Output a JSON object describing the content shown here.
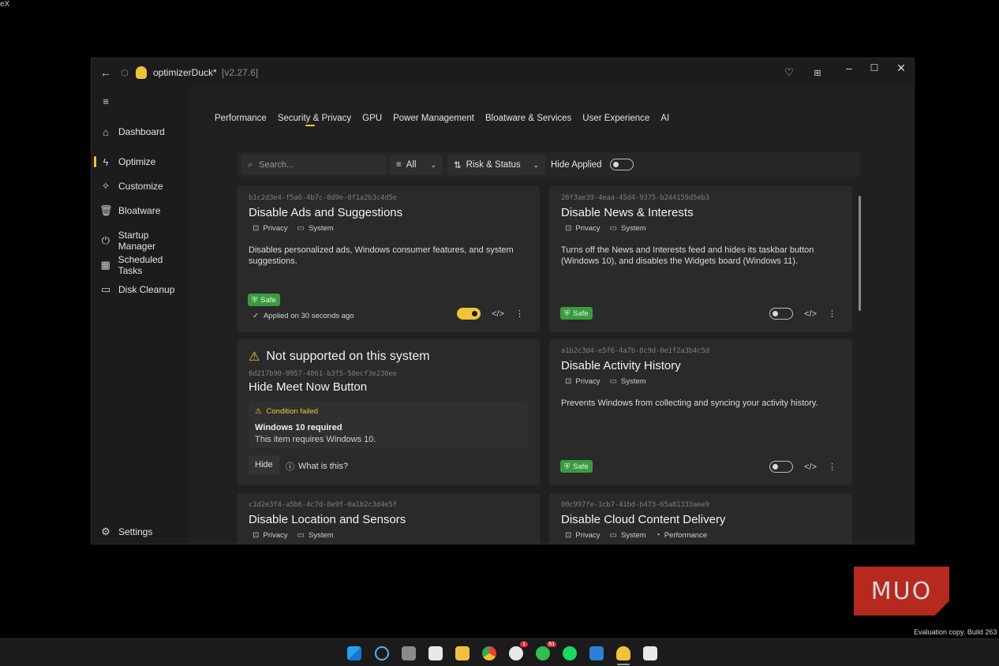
{
  "corner_text": "eX",
  "window": {
    "app_name": "optimizerDuck*",
    "version": "[v2.27.6]"
  },
  "sidebar": {
    "items": [
      {
        "label": "Dashboard"
      },
      {
        "label": "Optimize"
      },
      {
        "label": "Customize"
      },
      {
        "label": "Bloatware"
      },
      {
        "label": "Startup Manager"
      },
      {
        "label": "Scheduled Tasks"
      },
      {
        "label": "Disk Cleanup"
      }
    ],
    "settings_label": "Settings",
    "active": "Optimize"
  },
  "tabs": [
    "Performance",
    "Security & Privacy",
    "GPU",
    "Power Management",
    "Bloatware & Services",
    "User Experience",
    "AI"
  ],
  "toolbar": {
    "search_placeholder": "Search...",
    "filter_value": "All",
    "sort_value": "Risk & Status",
    "hide_applied_label": "Hide Applied"
  },
  "cards": [
    {
      "uuid": "b1c2d3e4-f5a6-4b7c-8d9e-0f1a2b3c4d5e",
      "title": "Disable Ads and Suggestions",
      "tags": [
        "Privacy",
        "System"
      ],
      "description": "Disables personalized ads, Windows consumer features, and system suggestions.",
      "badge": "Safe",
      "applied_text": "Applied on 30 seconds ago",
      "enabled": true
    },
    {
      "uuid": "26f3ae39-4eaa-45d4-9375-b244159d5eb3",
      "title": "Disable News & Interests",
      "tags": [
        "Privacy",
        "System"
      ],
      "description": "Turns off the News and Interests feed and hides its taskbar button (Windows 10), and disables the Widgets board (Windows 11).",
      "badge": "Safe",
      "enabled": false
    },
    {
      "warning": "Not supported on this system",
      "uuid": "6d217b90-0957-4861-b3f5-58ecf3e236ee",
      "title": "Hide Meet Now Button",
      "condition": "Condition failed",
      "requirement": "Windows 10 required",
      "requirement_detail": "This item requires Windows 10.",
      "hide_label": "Hide",
      "what_label": "What is this?"
    },
    {
      "uuid": "a1b2c3d4-e5f6-4a7b-8c9d-0e1f2a3b4c5d",
      "title": "Disable Activity History",
      "tags": [
        "Privacy",
        "System"
      ],
      "description": "Prevents Windows from collecting and syncing your activity history.",
      "badge": "Safe",
      "enabled": false
    },
    {
      "uuid": "c1d2e3f4-a5b6-4c7d-8e9f-0a1b2c3d4e5f",
      "title": "Disable Location and Sensors",
      "tags": [
        "Privacy",
        "System"
      ]
    },
    {
      "uuid": "00c997fe-1cb7-41bd-b473-65a81333aee9",
      "title": "Disable Cloud Content Delivery",
      "tags": [
        "Privacy",
        "System",
        "Performance"
      ]
    }
  ],
  "watermark": "MUO",
  "eval_text": "Evaluation copy. Build 263",
  "taskbar_badges": {
    "slack": "1",
    "whatsapp": "61"
  },
  "colors": {
    "accent": "#f0c43a",
    "safe": "#3a9b3f",
    "warning": "#e8c840"
  }
}
